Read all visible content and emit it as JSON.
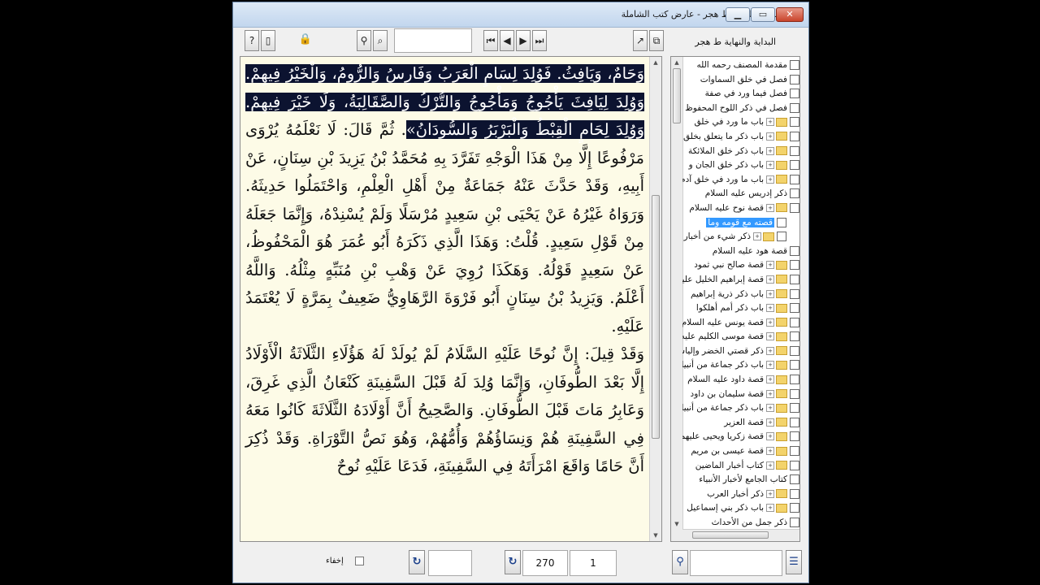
{
  "window": {
    "title": "البداية والنهاية ط هجر - عارض كتب الشاملة",
    "controls": {
      "minimize": "▁",
      "maximize": "▭",
      "close": "✕"
    }
  },
  "toolbar": {
    "book_label": "البداية والنهاية ط هجر",
    "search_value": "",
    "icons": [
      "help-icon",
      "page-icon",
      "lock-icon",
      "binoculars-icon",
      "search-page-icon",
      "first-page-icon",
      "prev-page-icon",
      "next-page-icon",
      "last-page-icon",
      "open-icon",
      "copy-icon"
    ],
    "glyphs": {
      "help": "?",
      "page": "▯",
      "lock": "🔒",
      "binoculars": "⚲",
      "search_page": "⌕",
      "first": "⏮",
      "prev": "◀",
      "next": "▶",
      "last": "⏭",
      "open": "↗",
      "copy": "⧉"
    }
  },
  "reader": {
    "paragraphs": [
      [
        {
          "text": "وَحَامٌ، وَيَافِثُ. فَوُلِدَ لِسَامٍ الْعَرَبُ وَفَارِسُ وَالرُّومُ، وَالْخَيْرُ فِيهِمْ. وَوُلِدَ لِيَافِثَ يَأْجُوجُ وَمَأْجُوجُ وَالتُّرْكُ وَالصَّقَالِبَةُ، وَلَا خَيْرَ فِيهِمْ. وَوُلِدَ لِحَامٍ الْقِبْطُ وَالْبَرْبَرُ وَالسُّودَانُ»",
          "highlight": true
        },
        {
          "text": ". ثُمَّ قَالَ: لَا نَعْلَمُهُ يُرْوَى مَرْفُوعًا إِلَّا مِنْ هَذَا الْوَجْهِ تَفَرَّدَ بِهِ مُحَمَّدُ بْنُ يَزِيدَ بْنِ سِنَانٍ، عَنْ أَبِيهِ، وَقَدْ حَدَّثَ عَنْهُ جَمَاعَةٌ مِنْ أَهْلِ الْعِلْمِ، وَاحْتَمَلُوا حَدِيثَهُ. وَرَوَاهُ غَيْرُهُ عَنْ يَحْيَى بْنِ سَعِيدٍ مُرْسَلًا وَلَمْ يُسْنِدْهُ، وَإِنَّمَا جَعَلَهُ مِنْ قَوْلِ سَعِيدٍ. قُلْتُ: وَهَذَا الَّذِي ذَكَرَهُ أَبُو عُمَرَ هُوَ الْمَحْفُوظُ، عَنْ سَعِيدٍ قَوْلُهُ. وَهَكَذَا رُوِيَ عَنْ وَهْبِ بْنِ مُنَبِّهٍ مِثْلُهُ. وَاللَّهُ أَعْلَمُ. وَيَزِيدُ بْنُ سِنَانٍ أَبُو فَرْوَةَ الرَّهَاوِيُّ ضَعِيفٌ بِمَرَّةٍ لَا يُعْتَمَدُ عَلَيْهِ.",
          "highlight": false
        }
      ],
      [
        {
          "text": "وَقَدْ قِيلَ: إِنَّ نُوحًا عَلَيْهِ السَّلَامُ لَمْ يُولَدْ لَهُ هَؤُلَاءِ الثَّلَاثَةُ الْأَوْلَادُ إِلَّا بَعْدَ الطُّوفَانِ، وَإِنَّمَا وُلِدَ لَهُ قَبْلَ السَّفِينَةِ كَنْعَانُ الَّذِي غَرِقَ، وَعَابِرُ مَاتَ قَبْلَ الطُّوفَانِ. وَالصَّحِيحُ أَنَّ أَوْلَادَهُ الثَّلَاثَةَ كَانُوا مَعَهُ فِي السَّفِينَةِ هُمْ وَنِسَاؤُهُمْ وَأُمُّهُمْ، وَهُوَ نَصُّ التَّوْرَاةِ. وَقَدْ ذُكِرَ أَنَّ حَامًا وَاقَعَ امْرَأَتَهُ فِي السَّفِينَةِ، فَدَعَا عَلَيْهِ نُوحٌ",
          "highlight": false
        }
      ]
    ]
  },
  "tree": {
    "items": [
      {
        "label": "مقدمة المصنف رحمه الله",
        "folder": false,
        "expander": false,
        "child": false
      },
      {
        "label": "فصل في خلق السماوات",
        "folder": false,
        "expander": false,
        "child": false
      },
      {
        "label": "فصل فيما ورد في صفة",
        "folder": false,
        "expander": false,
        "child": false
      },
      {
        "label": "فصل في ذكر اللوح المحفوظ",
        "folder": false,
        "expander": false,
        "child": false
      },
      {
        "label": "باب ما ورد في خلق",
        "folder": true,
        "expander": true,
        "child": false
      },
      {
        "label": "باب ذكر ما يتعلق بخلق",
        "folder": true,
        "expander": true,
        "child": false
      },
      {
        "label": "باب ذكر خلق الملائكة",
        "folder": true,
        "expander": true,
        "child": false
      },
      {
        "label": "باب ذكر خلق الجان و",
        "folder": true,
        "expander": true,
        "child": false
      },
      {
        "label": "باب ما ورد في خلق آدم",
        "folder": true,
        "expander": true,
        "child": false
      },
      {
        "label": "ذكر إدريس عليه السلام",
        "folder": false,
        "expander": false,
        "child": false
      },
      {
        "label": "قصة نوح عليه السلام",
        "folder": true,
        "expander": true,
        "child": false
      },
      {
        "label": "قصته مع قومه وما",
        "folder": false,
        "expander": false,
        "child": true,
        "selected": true
      },
      {
        "label": "ذكر شيء من أخبار",
        "folder": true,
        "expander": true,
        "child": true
      },
      {
        "label": "قصة هود عليه السلام",
        "folder": false,
        "expander": false,
        "child": false
      },
      {
        "label": "قصة صالح نبي ثمود",
        "folder": true,
        "expander": true,
        "child": false
      },
      {
        "label": "قصة إبراهيم الخليل عليه",
        "folder": true,
        "expander": true,
        "child": false
      },
      {
        "label": "باب ذكر ذرية إبراهيم",
        "folder": true,
        "expander": true,
        "child": false
      },
      {
        "label": "باب ذكر أمم أهلكوا",
        "folder": true,
        "expander": true,
        "child": false
      },
      {
        "label": "قصة يونس عليه السلام",
        "folder": true,
        "expander": true,
        "child": false
      },
      {
        "label": "قصة موسى الكليم عليه",
        "folder": true,
        "expander": true,
        "child": false
      },
      {
        "label": "ذكر قصتي الخضر وإلياس",
        "folder": true,
        "expander": true,
        "child": false
      },
      {
        "label": "باب ذكر جماعة من أنبياء",
        "folder": true,
        "expander": true,
        "child": false
      },
      {
        "label": "قصة داود عليه السلام",
        "folder": true,
        "expander": true,
        "child": false
      },
      {
        "label": "قصة سليمان بن داود",
        "folder": true,
        "expander": true,
        "child": false
      },
      {
        "label": "باب ذكر جماعة من أنبياء",
        "folder": true,
        "expander": true,
        "child": false
      },
      {
        "label": "قصة العزير",
        "folder": true,
        "expander": true,
        "child": false
      },
      {
        "label": "قصة زكريا ويحيى عليهما",
        "folder": true,
        "expander": true,
        "child": false
      },
      {
        "label": "قصة عيسى بن مريم",
        "folder": true,
        "expander": true,
        "child": false
      },
      {
        "label": "كتاب أخبار الماضين",
        "folder": true,
        "expander": true,
        "child": false
      },
      {
        "label": "كتاب الجامع لأخبار الأنبياء",
        "folder": false,
        "expander": false,
        "child": false
      },
      {
        "label": "ذكر أخبار العرب",
        "folder": true,
        "expander": true,
        "child": false
      },
      {
        "label": "باب ذكر بني إسماعيل",
        "folder": true,
        "expander": true,
        "child": false
      },
      {
        "label": "ذكر جمل من الأحداث",
        "folder": false,
        "expander": false,
        "child": false
      }
    ]
  },
  "status": {
    "hide_label": "إخفاء",
    "input_a": "",
    "page_total": "270",
    "page_current": "1",
    "search_value": "",
    "refresh_glyph": "↻",
    "binoculars_glyph": "⚲",
    "list_glyph": "☰"
  }
}
